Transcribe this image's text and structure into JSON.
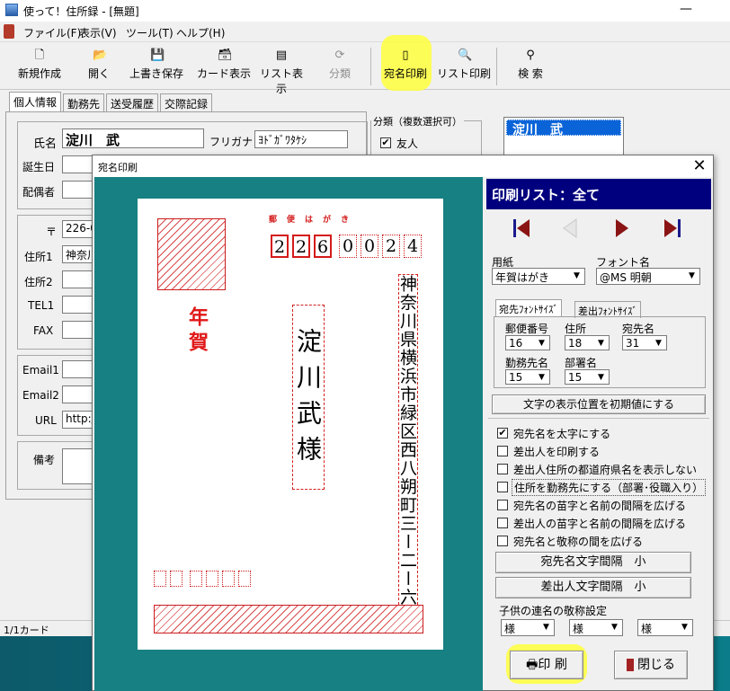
{
  "app": {
    "title": "使って！住所録 - [無題]",
    "menu": [
      "ファイル(F)",
      "表示(V)",
      "ツール(T)",
      "ヘルプ(H)"
    ],
    "toolbar": {
      "new": "新規作成",
      "open": "開く",
      "save": "上書き保存",
      "card": "カード表示",
      "list": "リスト表示",
      "classify": "分類",
      "address_print": "宛名印刷",
      "list_print": "リスト印刷",
      "search": "検 索"
    },
    "tabs": [
      "個人情報",
      "勤務先",
      "送受履歴",
      "交際記録"
    ],
    "personal": {
      "name_label": "氏名",
      "name_value": "淀川　武",
      "furigana_label": "フリガナ",
      "furigana_value": "ﾖﾄﾞｶﾞﾜﾀｹｼ",
      "birthday_label": "誕生日",
      "spouse_label": "配偶者",
      "postal_label": "〒",
      "postal_value": "226-0",
      "address1_label": "住所1",
      "address1_value": "神奈川",
      "address2_label": "住所2",
      "tel1_label": "TEL1",
      "fax_label": "FAX",
      "email1_label": "Email1",
      "email2_label": "Email2",
      "url_label": "URL",
      "url_value": "http:/",
      "memo_label": "備考"
    },
    "category": {
      "title": "分類（複数選択可）",
      "item": "友人"
    },
    "name_list": [
      "淀川　武"
    ],
    "status": "1/1カード"
  },
  "dialog": {
    "title": "宛名印刷",
    "close_icon": "close-icon",
    "card": {
      "postcard_label": "郵　便　は　が　き",
      "zip_digits": [
        "2",
        "2",
        "6",
        "0",
        "0",
        "2",
        "4"
      ],
      "nenga": "年賀",
      "recipient_name": "淀川武様",
      "address": "神奈川県横浜市緑区西八朔町三ー二ー六"
    },
    "print_list": "印刷リスト：全て",
    "paper_label": "用紙",
    "paper_value": "年賀はがき",
    "font_label": "フォント名",
    "font_value": "@MS 明朝",
    "subtabs": [
      "宛先ﾌｫﾝﾄｻｲｽﾞ",
      "差出ﾌｫﾝﾄｻｲｽﾞ"
    ],
    "sizes": {
      "postal_label": "郵便番号",
      "postal_value": "16",
      "address_label": "住所",
      "address_value": "18",
      "name_label": "宛先名",
      "name_value": "31",
      "company_label": "勤務先名",
      "company_value": "15",
      "dept_label": "部署名",
      "dept_value": "15"
    },
    "reset_button": "文字の表示位置を初期値にする",
    "options": [
      {
        "label": "宛先名を太字にする",
        "checked": true
      },
      {
        "label": "差出人を印刷する",
        "checked": false
      },
      {
        "label": "差出人住所の都道府県名を表示しない",
        "checked": false
      },
      {
        "label": "住所を勤務先にする（部署･役職入り）",
        "checked": false
      },
      {
        "label": "宛先名の苗字と名前の間隔を広げる",
        "checked": false
      },
      {
        "label": "差出人の苗字と名前の間隔を広げる",
        "checked": false
      },
      {
        "label": "宛先名と敬称の間を広げる",
        "checked": false
      }
    ],
    "name_spacing_button": "宛先名文字間隔　小",
    "sender_spacing_button": "差出人文字間隔　小",
    "child_honorific_label": "子供の連名の敬称設定",
    "honorifics": [
      "様",
      "様",
      "様"
    ],
    "print_button": "印 刷",
    "close_button": "閉じる",
    "colors": {
      "header_bg": "#00007e",
      "preview_bg": "#178082",
      "stamp_red": "#d41a1a",
      "highlight": "#ffff3c"
    }
  }
}
